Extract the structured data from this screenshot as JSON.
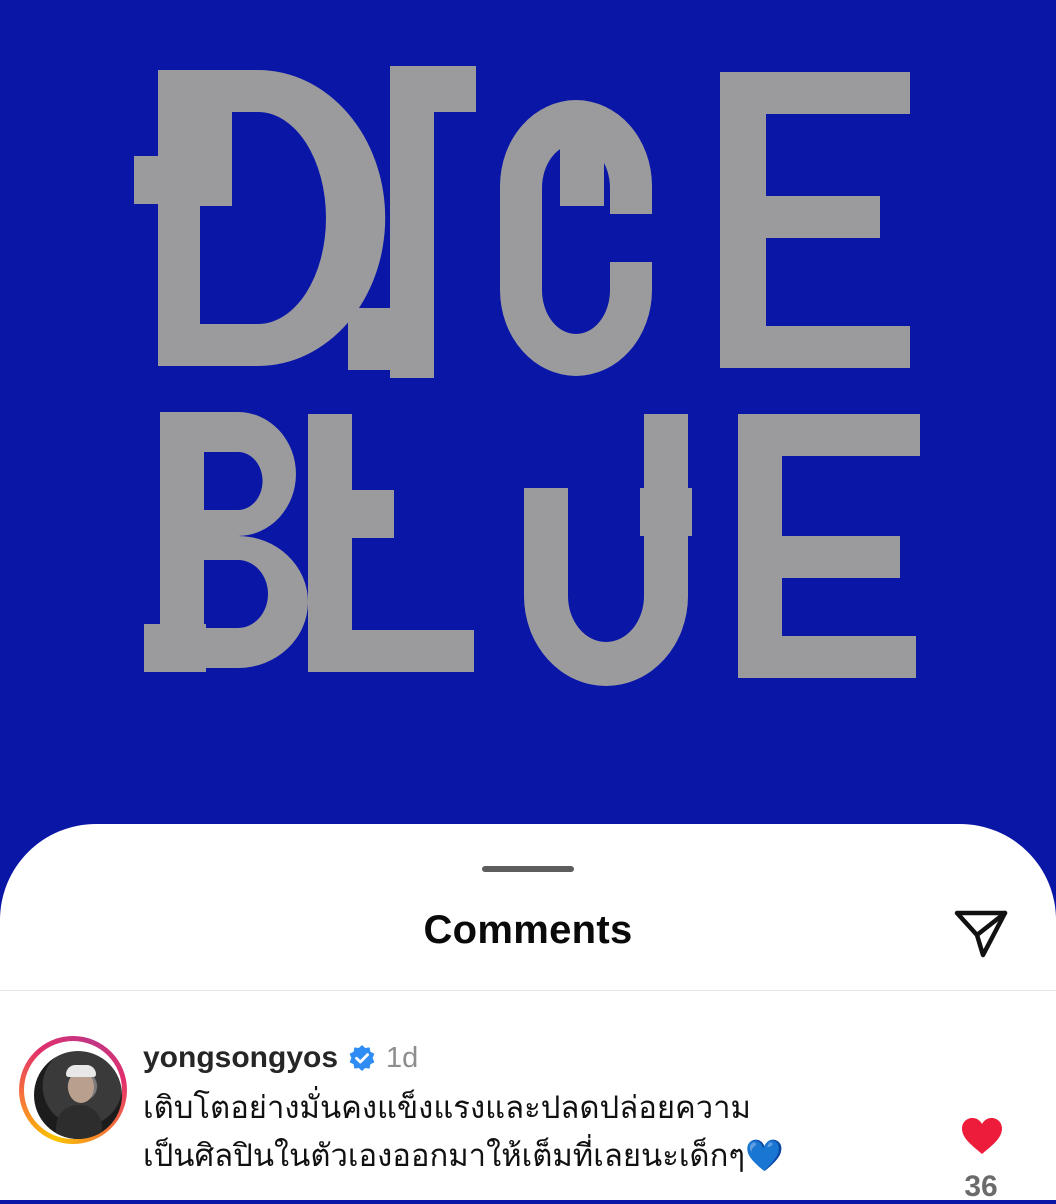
{
  "post": {
    "image_text": [
      "DICE",
      "BLUE"
    ],
    "background_color": "#0a17a6",
    "letter_color": "#9b9b9e"
  },
  "comments_sheet": {
    "title": "Comments",
    "share_icon": "paper-plane-icon"
  },
  "comments": [
    {
      "username": "yongsongyos",
      "verified": true,
      "time": "1d",
      "text_line1": "เติบโตอย่างมั่นคงแข็งแรงและปลดปล่อยความ",
      "text_line2": "เป็นศิลปินในตัวเองออกมาให้เต็มที่เลยนะเด็กๆ💙",
      "like_icon": "heart-filled-icon",
      "like_color": "#ed1c3a",
      "likes": "36"
    }
  ]
}
